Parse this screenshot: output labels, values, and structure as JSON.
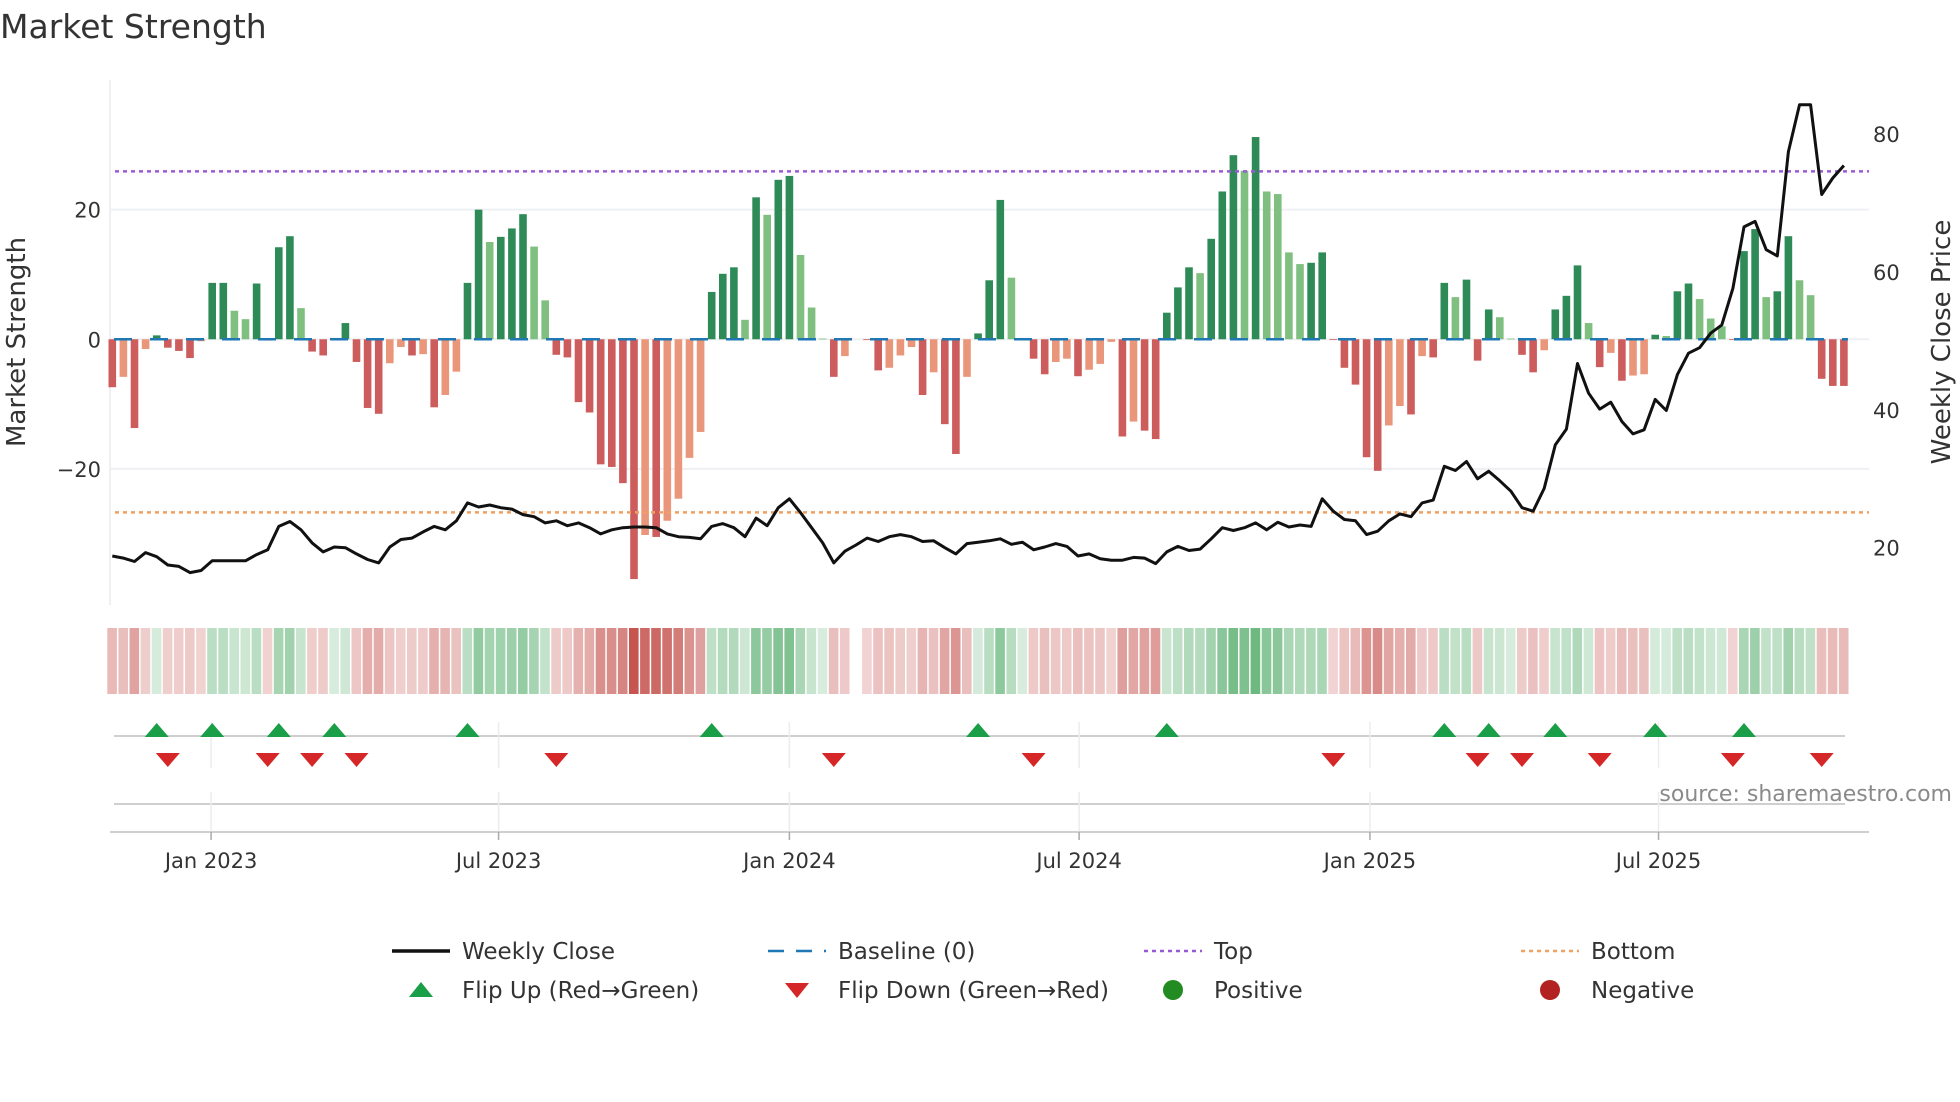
{
  "chart_data": {
    "type": "bar",
    "title": "Market Strength",
    "ylabel_left": "Market Strength",
    "ylabel_right": "Weekly Close Price",
    "source": "source: sharemaestro.com",
    "ylim_left": [
      -41,
      40
    ],
    "ylim_right": [
      11.7,
      87.8
    ],
    "xlim_weeks": [
      0.8,
      158.5
    ],
    "yticks_left": [
      {
        "value": 20,
        "label": "20"
      },
      {
        "value": 0,
        "label": "0"
      },
      {
        "value": -20,
        "label": "−20"
      }
    ],
    "yticks_right": [
      {
        "value": 20,
        "label": "20"
      },
      {
        "value": 40,
        "label": "40"
      },
      {
        "value": 60,
        "label": "60"
      },
      {
        "value": 80,
        "label": "80"
      }
    ],
    "xticks": [
      {
        "week": 9.9,
        "label": "Jan 2023"
      },
      {
        "week": 35.8,
        "label": "Jul 2023"
      },
      {
        "week": 62.0,
        "label": "Jan 2024"
      },
      {
        "week": 88.1,
        "label": "Jul 2024"
      },
      {
        "week": 114.3,
        "label": "Jan 2025"
      },
      {
        "week": 140.3,
        "label": "Jul 2025"
      }
    ],
    "top_level": 25.9,
    "bottom_level": -26.7,
    "baseline": 0,
    "grid": true,
    "colors": {
      "strong_pos": "#2e8b57",
      "weak_pos": "#7fbf7f",
      "strong_neg": "#cd5c5c",
      "weak_neg": "#e9967a",
      "close": "#111111",
      "baseline": "#1f77b4",
      "top": "#9b59d6",
      "bottom": "#f0a060",
      "flip_up": "#1a9e47",
      "flip_down": "#d62728",
      "positive": "#228b22",
      "negative": "#b22222"
    },
    "series": [
      {
        "name": "Market Strength",
        "values": [
          -7.4,
          -5.8,
          -13.7,
          -1.5,
          0.6,
          -1.3,
          -1.8,
          -2.9,
          -0.3,
          8.7,
          8.7,
          4.4,
          3.1,
          8.6,
          -0.2,
          14.2,
          15.9,
          4.8,
          -1.9,
          -2.5,
          0.2,
          2.5,
          -3.5,
          -10.6,
          -11.5,
          -3.7,
          -1.2,
          -2.5,
          -2.3,
          -10.5,
          -8.6,
          -5.0,
          8.7,
          20.0,
          15.0,
          15.8,
          17.1,
          19.3,
          14.3,
          6.0,
          -2.4,
          -2.8,
          -9.7,
          -11.3,
          -19.3,
          -19.7,
          -22.2,
          -37.0,
          -30.2,
          -30.5,
          -28.0,
          -24.6,
          -18.3,
          -14.3,
          7.3,
          10.1,
          11.1,
          3.0,
          21.9,
          19.2,
          24.6,
          25.2,
          13.0,
          4.9,
          0.1,
          -5.8,
          -2.6,
          null,
          -0.1,
          -4.8,
          -4.4,
          -2.5,
          -1.2,
          -8.6,
          -5.1,
          -13.1,
          -17.7,
          -5.8,
          0.9,
          9.1,
          21.5,
          9.5,
          0.1,
          -3.0,
          -5.4,
          -3.5,
          -3.0,
          -5.7,
          -4.7,
          -3.8,
          -0.4,
          -15.0,
          -12.7,
          -14.1,
          -15.4,
          4.1,
          8.0,
          11.1,
          10.2,
          15.5,
          22.8,
          28.4,
          26.0,
          31.2,
          22.8,
          22.4,
          13.4,
          11.6,
          11.8,
          13.4,
          -0.1,
          -4.4,
          -7.0,
          -18.2,
          -20.3,
          -13.3,
          -10.3,
          -11.6,
          -2.6,
          -2.8,
          8.7,
          6.5,
          9.2,
          -3.3,
          4.6,
          3.4,
          0.1,
          -2.4,
          -5.1,
          -1.7,
          4.6,
          6.7,
          11.4,
          2.5,
          -4.3,
          -2.1,
          -6.4,
          -5.6,
          -5.4,
          0.7,
          0.5,
          7.4,
          8.6,
          6.2,
          3.2,
          2.0,
          -0.1,
          13.6,
          17.0,
          6.5,
          7.4,
          15.9,
          9.1,
          6.8,
          -6.1,
          -7.2,
          -7.2
        ]
      },
      {
        "name": "Weekly Close",
        "axis": "right",
        "values": [
          18.8,
          18.5,
          18.0,
          19.3,
          18.7,
          17.5,
          17.3,
          16.4,
          16.7,
          18.1,
          18.1,
          18.1,
          18.1,
          19.0,
          19.7,
          23.1,
          23.8,
          22.6,
          20.7,
          19.4,
          20.1,
          20.0,
          19.1,
          18.3,
          17.8,
          20.1,
          21.2,
          21.4,
          22.3,
          23.1,
          22.6,
          23.9,
          26.5,
          25.9,
          26.2,
          25.8,
          25.6,
          24.8,
          24.5,
          23.6,
          23.9,
          23.2,
          23.6,
          22.9,
          22.0,
          22.6,
          22.9,
          23.0,
          23.0,
          22.9,
          22.0,
          21.6,
          21.5,
          21.3,
          23.1,
          23.5,
          22.9,
          21.6,
          24.3,
          23.2,
          25.8,
          27.1,
          25.1,
          22.9,
          20.7,
          17.8,
          19.5,
          20.4,
          21.4,
          20.9,
          21.6,
          21.9,
          21.6,
          20.9,
          21.0,
          20.0,
          19.1,
          20.6,
          20.8,
          21.0,
          21.3,
          20.5,
          20.8,
          19.7,
          20.1,
          20.6,
          20.2,
          18.8,
          19.1,
          18.4,
          18.2,
          18.2,
          18.6,
          18.5,
          17.7,
          19.4,
          20.2,
          19.6,
          19.8,
          21.3,
          22.9,
          22.5,
          22.9,
          23.6,
          22.6,
          23.7,
          23.0,
          23.3,
          23.1,
          27.1,
          25.3,
          24.1,
          23.9,
          21.9,
          22.4,
          23.9,
          24.9,
          24.5,
          26.5,
          26.9,
          31.8,
          31.2,
          32.5,
          30.0,
          31.1,
          29.7,
          28.2,
          25.8,
          25.3,
          28.6,
          34.9,
          37.2,
          46.7,
          42.4,
          40.1,
          41.1,
          38.3,
          36.5,
          37.1,
          41.5,
          39.9,
          45.1,
          48.2,
          49.0,
          51.1,
          52.3,
          57.6,
          66.5,
          67.3,
          63.2,
          62.3,
          77.4,
          84.2,
          84.2,
          71.2,
          73.6,
          75.4
        ]
      }
    ],
    "flip_up_weeks": [
      5,
      10,
      16,
      21,
      33,
      55,
      79,
      96,
      121,
      125,
      131,
      140,
      148
    ],
    "flip_down_weeks": [
      6,
      15,
      19,
      23,
      41,
      66,
      84,
      111,
      124,
      128,
      135,
      147,
      155
    ],
    "legend": {
      "placement": "bottom",
      "items": [
        {
          "key": "close",
          "label": "Weekly Close"
        },
        {
          "key": "baseline",
          "label": "Baseline (0)"
        },
        {
          "key": "top",
          "label": "Top"
        },
        {
          "key": "bottom",
          "label": "Bottom"
        },
        {
          "key": "flip_up",
          "label": "Flip Up (Red→Green)"
        },
        {
          "key": "flip_down",
          "label": "Flip Down (Green→Red)"
        },
        {
          "key": "positive",
          "label": "Positive"
        },
        {
          "key": "negative",
          "label": "Negative"
        }
      ]
    }
  }
}
